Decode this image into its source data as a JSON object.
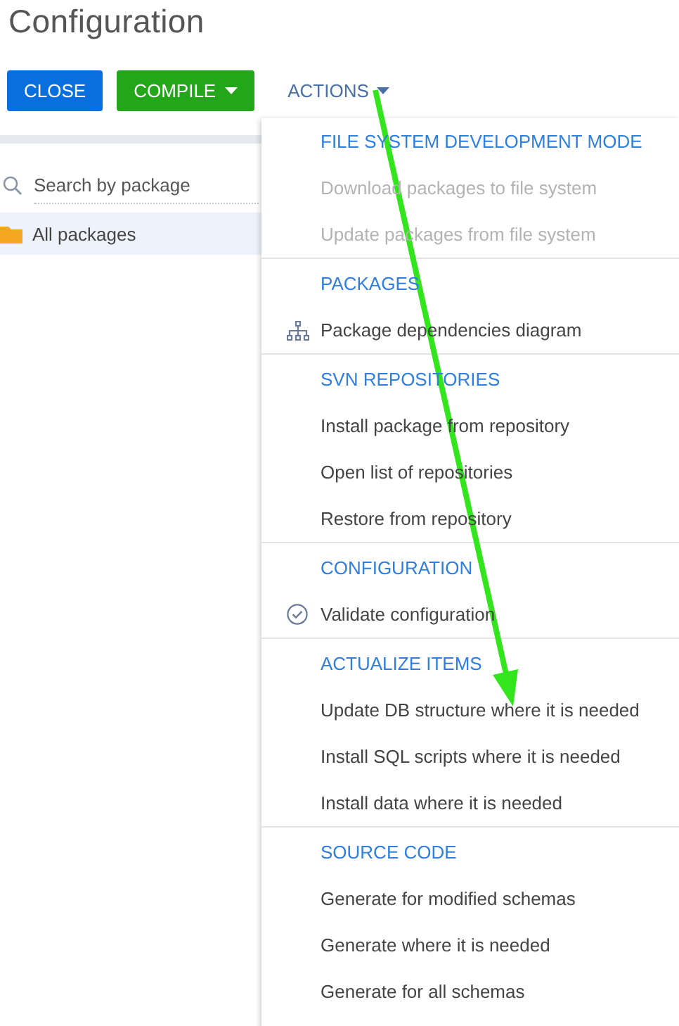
{
  "title": "Configuration",
  "toolbar": {
    "close": "CLOSE",
    "compile": "COMPILE",
    "actions": "ACTIONS"
  },
  "sidebar": {
    "search": {
      "placeholder": "Search by package"
    },
    "items": [
      {
        "label": "All packages",
        "selected": true
      }
    ]
  },
  "menu": {
    "sections": [
      {
        "header": "FILE SYSTEM DEVELOPMENT MODE",
        "items": [
          {
            "label": "Download packages to file system",
            "disabled": true,
            "kind": "plain"
          },
          {
            "label": "Update packages from file system",
            "disabled": true,
            "kind": "plain"
          }
        ]
      },
      {
        "header": "PACKAGES",
        "items": [
          {
            "label": "Package dependencies diagram",
            "disabled": false,
            "kind": "diagram"
          }
        ]
      },
      {
        "header": "SVN REPOSITORIES",
        "items": [
          {
            "label": "Install package from repository",
            "disabled": false,
            "kind": "plain"
          },
          {
            "label": "Open list of repositories",
            "disabled": false,
            "kind": "plain"
          },
          {
            "label": "Restore from repository",
            "disabled": false,
            "kind": "plain"
          }
        ]
      },
      {
        "header": "CONFIGURATION",
        "items": [
          {
            "label": "Validate configuration",
            "disabled": false,
            "kind": "validate"
          }
        ]
      },
      {
        "header": "ACTUALIZE ITEMS",
        "items": [
          {
            "label": "Update DB structure where it is needed",
            "disabled": false,
            "kind": "plain"
          },
          {
            "label": "Install SQL scripts where it is needed",
            "disabled": false,
            "kind": "plain"
          },
          {
            "label": "Install data where it is needed",
            "disabled": false,
            "kind": "plain"
          }
        ]
      },
      {
        "header": "SOURCE CODE",
        "items": [
          {
            "label": "Generate for modified schemas",
            "disabled": false,
            "kind": "plain"
          },
          {
            "label": "Generate where it is needed",
            "disabled": false,
            "kind": "plain"
          },
          {
            "label": "Generate for all schemas",
            "disabled": false,
            "kind": "plain"
          }
        ]
      }
    ]
  }
}
